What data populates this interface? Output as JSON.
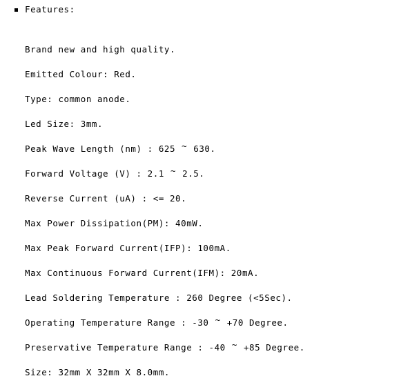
{
  "document": {
    "heading": {
      "bullet_icon": "bullet-dot-icon",
      "label": "Features:"
    },
    "features": [
      {
        "text": "Brand new and high quality."
      },
      {
        "text": "Emitted Colour: Red."
      },
      {
        "text": "Type: common anode."
      },
      {
        "text": "Led Size: 3mm."
      },
      {
        "prefix": "Peak Wave Length (nm) : 625 ",
        "tilde": "~",
        "suffix": " 630."
      },
      {
        "prefix": "Forward Voltage (V) : 2.1 ",
        "tilde": "~",
        "suffix": " 2.5."
      },
      {
        "text": "Reverse Current (uA) : <= 20."
      },
      {
        "text": "Max Power Dissipation(PM): 40mW."
      },
      {
        "text": "Max Peak Forward Current(IFP): 100mA."
      },
      {
        "text": "Max Continuous Forward Current(IFM): 20mA."
      },
      {
        "text": "Lead Soldering Temperature : 260 Degree (<5Sec)."
      },
      {
        "prefix": "Operating Temperature Range : -30 ",
        "tilde": "~",
        "suffix": " +70 Degree."
      },
      {
        "prefix": "Preservative Temperature Range : -40 ",
        "tilde": "~",
        "suffix": " +85 Degree."
      },
      {
        "text": "Size: 32mm X 32mm X 8.0mm."
      }
    ],
    "colors": {
      "background": "#ffffff",
      "text": "#000000"
    }
  }
}
